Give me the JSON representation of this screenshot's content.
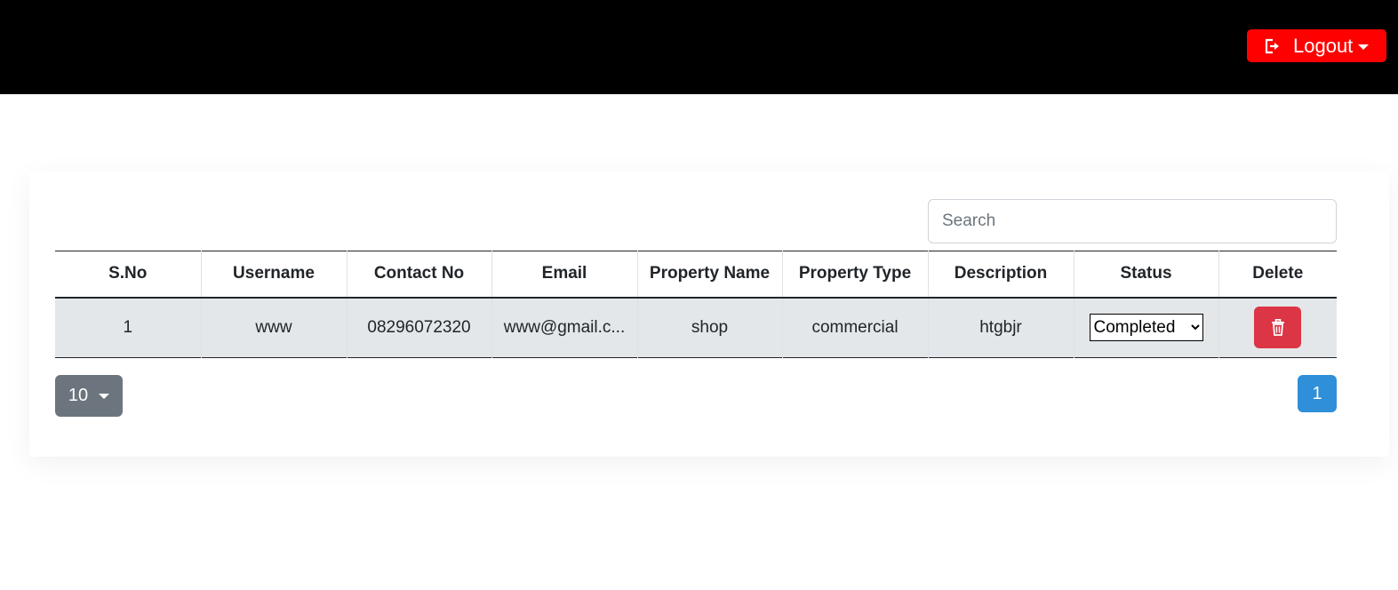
{
  "header": {
    "logout_label": "Logout",
    "logout_icon": "sign-out-icon",
    "logout_color": "#ff0000"
  },
  "search": {
    "placeholder": "Search",
    "value": ""
  },
  "table": {
    "columns": [
      "S.No",
      "Username",
      "Contact No",
      "Email",
      "Property Name",
      "Property Type",
      "Description",
      "Status",
      "Delete"
    ],
    "rows": [
      {
        "sno": "1",
        "username": "www",
        "contact": "08296072320",
        "email": "www@gmail.c...",
        "property_name": "shop",
        "property_type": "commercial",
        "description": "htgbjr",
        "status": "Completed",
        "delete_icon": "trash-icon"
      }
    ]
  },
  "pagination": {
    "page_size": "10",
    "current_page": "1"
  },
  "colors": {
    "danger": "#dc3545",
    "primary": "#2f8fd8",
    "secondary": "#6c757d"
  }
}
